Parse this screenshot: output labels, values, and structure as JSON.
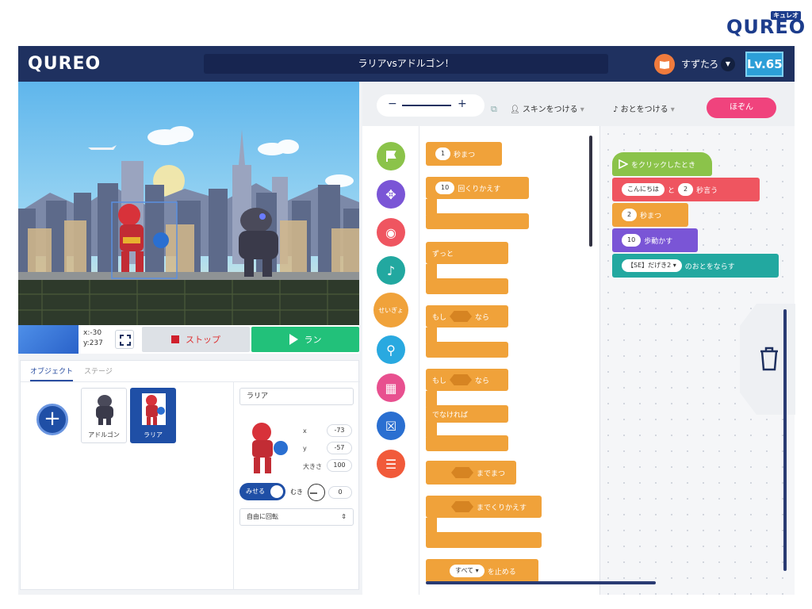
{
  "brand": {
    "corner_logo": "QUREO",
    "corner_ruby": "キュレオ",
    "app_logo": "QUREO"
  },
  "header": {
    "project_title": "ラリアvsアドルゴン！",
    "user_name": "すずたろ",
    "level": "Lv.65"
  },
  "stage": {
    "coord_x": "x:-30",
    "coord_y": "y:237",
    "stop_label": "ストップ",
    "run_label": "ラン"
  },
  "objects": {
    "tabs": [
      "オブジェクト",
      "ステージ"
    ],
    "sprites": [
      {
        "label": "アドルゴン"
      },
      {
        "label": "ラリア"
      }
    ],
    "selected": {
      "name": "ラリア",
      "x_label": "x",
      "x": "-73",
      "y_label": "y",
      "y": "-57",
      "size_label": "大きさ",
      "size": "100",
      "show_label": "みせる",
      "direction_label": "むき",
      "direction": "0",
      "rotation": "自由に回転"
    }
  },
  "toolbar": {
    "zoom_minus": "−",
    "zoom_plus": "+",
    "skin_label": "スキンをつける",
    "sound_label": "おとをつける",
    "save_label": "ほぞん"
  },
  "categories": [
    {
      "name": "flag-icon",
      "color": "#8bc34a"
    },
    {
      "name": "move-icon",
      "color": "#7a55d6"
    },
    {
      "name": "looks-icon",
      "color": "#ef5560"
    },
    {
      "name": "music-icon",
      "color": "#22a8a0"
    },
    {
      "name": "control",
      "label": "せいぎょ",
      "color": "#f0a23a"
    },
    {
      "name": "search-icon",
      "color": "#29a9e0"
    },
    {
      "name": "calc-icon",
      "color": "#e8508f"
    },
    {
      "name": "variable-icon",
      "color": "#2a6fd1"
    },
    {
      "name": "list-icon",
      "color": "#f15a3a"
    }
  ],
  "palette": {
    "wait_value": "1",
    "wait_label": "秒まつ",
    "repeat_value": "10",
    "repeat_label": "回くりかえす",
    "forever_label": "ずっと",
    "if_label": "もし",
    "then_label": "なら",
    "if2_label": "もし",
    "then2_label": "なら",
    "else_label": "でなければ",
    "wait_until_label": "までまつ",
    "repeat_until_label": "までくりかえす",
    "stop_value": "すべて ▾",
    "stop_label": "を止める"
  },
  "script": {
    "hat_label": "をクリックしたとき",
    "say_text": "こんにちは",
    "say_mid": "と",
    "say_secs": "2",
    "say_label": "秒言う",
    "wait_value": "2",
    "wait_label": "秒まつ",
    "move_value": "10",
    "move_label": "歩動かす",
    "sound_value": "【SE】だげき2 ▾",
    "sound_label": "のおとをならす"
  }
}
